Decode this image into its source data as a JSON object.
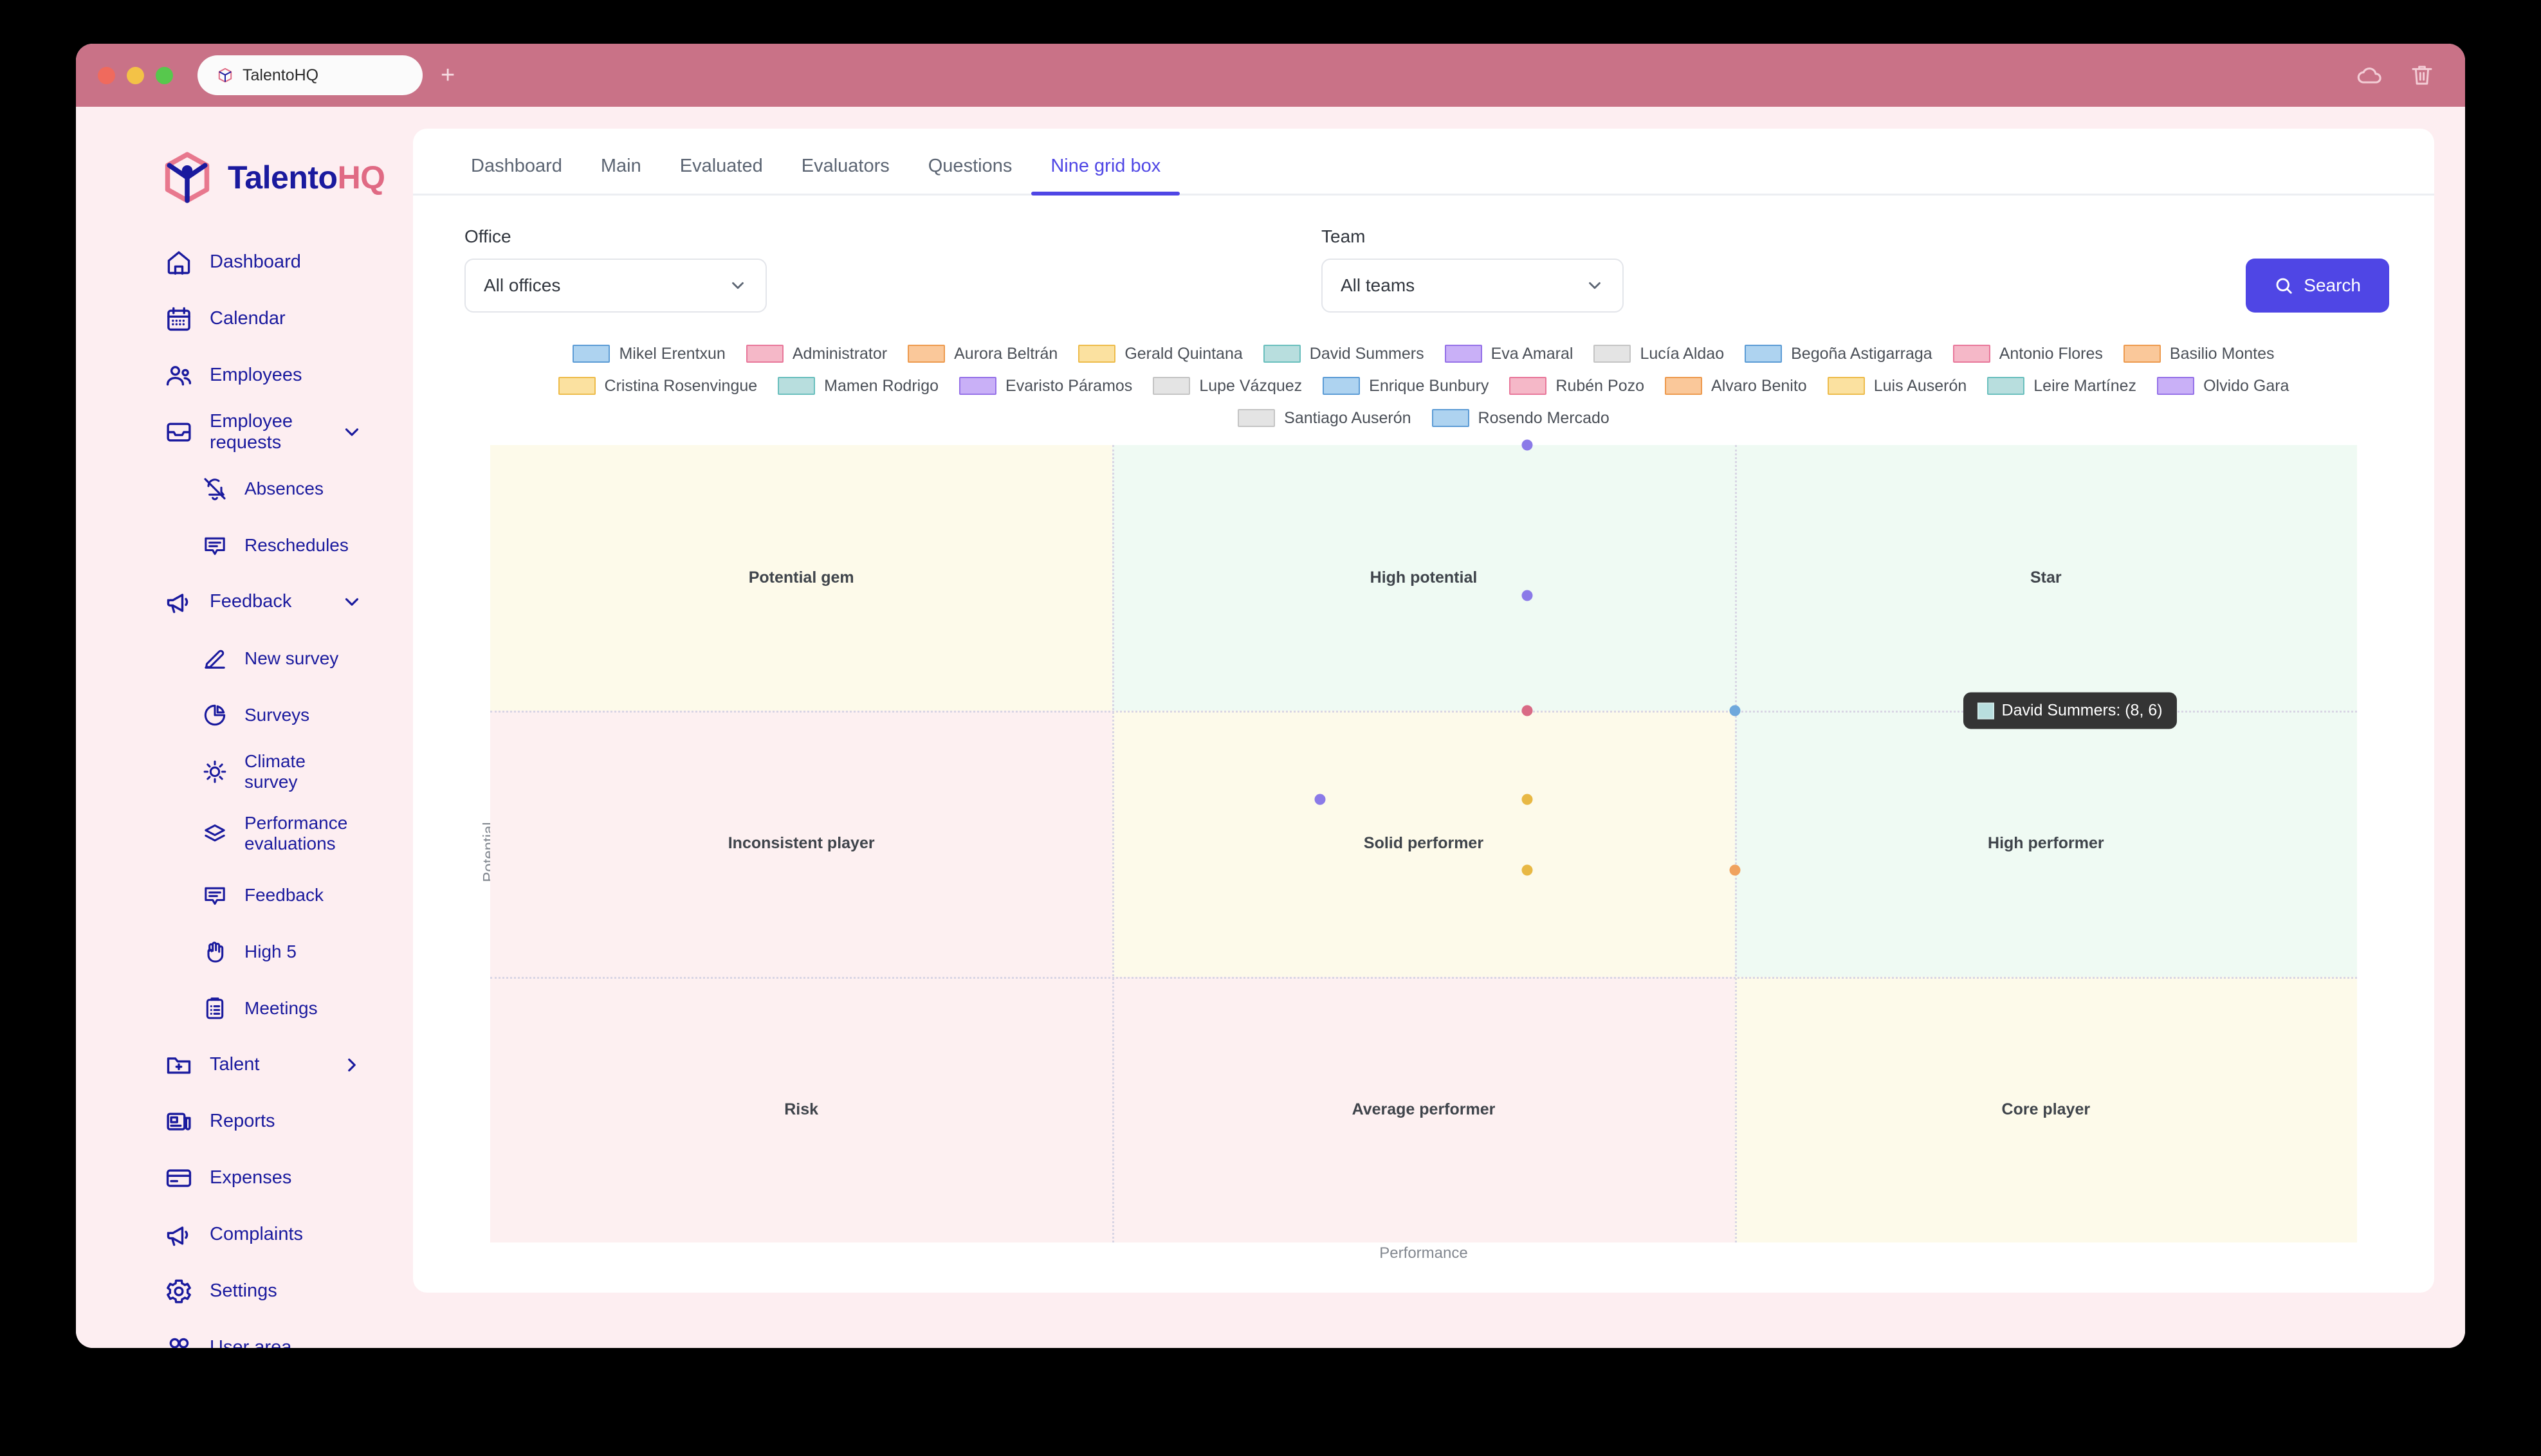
{
  "browser": {
    "tab_title": "TalentoHQ",
    "favicon": "cube-icon",
    "new_tab": "+",
    "cloud_icon": "cloud-icon",
    "trash_icon": "trash-icon"
  },
  "brand": {
    "name_primary": "Talento",
    "name_accent": "HQ",
    "logo": "cube-person-logo"
  },
  "sidebar": {
    "items": [
      {
        "label": "Dashboard",
        "icon": "home-icon",
        "level": 0,
        "chevron": ""
      },
      {
        "label": "Calendar",
        "icon": "calendar-icon",
        "level": 0,
        "chevron": ""
      },
      {
        "label": "Employees",
        "icon": "people-icon",
        "level": 0,
        "chevron": ""
      },
      {
        "label": "Employee requests",
        "icon": "inbox-icon",
        "level": 0,
        "chevron": "down"
      },
      {
        "label": "Absences",
        "icon": "bell-off-icon",
        "level": 1,
        "chevron": ""
      },
      {
        "label": "Reschedules",
        "icon": "chat-icon",
        "level": 1,
        "chevron": ""
      },
      {
        "label": "Feedback",
        "icon": "megaphone-icon",
        "level": 0,
        "chevron": "down"
      },
      {
        "label": "New survey",
        "icon": "edit-icon",
        "level": 1,
        "chevron": ""
      },
      {
        "label": "Surveys",
        "icon": "pie-chart-icon",
        "level": 1,
        "chevron": ""
      },
      {
        "label": "Climate survey",
        "icon": "sun-icon",
        "level": 1,
        "chevron": ""
      },
      {
        "label": "Performance evaluations",
        "icon": "layers-icon",
        "level": 1,
        "chevron": ""
      },
      {
        "label": "Feedback",
        "icon": "chat-icon",
        "level": 1,
        "chevron": ""
      },
      {
        "label": "High 5",
        "icon": "hand-icon",
        "level": 1,
        "chevron": ""
      },
      {
        "label": "Meetings",
        "icon": "clipboard-icon",
        "level": 1,
        "chevron": ""
      },
      {
        "label": "Talent",
        "icon": "folder-plus-icon",
        "level": 0,
        "chevron": "right"
      },
      {
        "label": "Reports",
        "icon": "news-icon",
        "level": 0,
        "chevron": ""
      },
      {
        "label": "Expenses",
        "icon": "card-icon",
        "level": 0,
        "chevron": ""
      },
      {
        "label": "Complaints",
        "icon": "megaphone-icon",
        "level": 0,
        "chevron": ""
      },
      {
        "label": "Settings",
        "icon": "gear-icon",
        "level": 0,
        "chevron": ""
      },
      {
        "label": "User area",
        "icon": "user-icon",
        "level": 0,
        "chevron": ""
      }
    ]
  },
  "tabs": [
    {
      "label": "Dashboard",
      "active": false
    },
    {
      "label": "Main",
      "active": false
    },
    {
      "label": "Evaluated",
      "active": false
    },
    {
      "label": "Evaluators",
      "active": false
    },
    {
      "label": "Questions",
      "active": false
    },
    {
      "label": "Nine grid box",
      "active": true
    }
  ],
  "filters": {
    "office_label": "Office",
    "office_value": "All offices",
    "team_label": "Team",
    "team_value": "All teams",
    "search_label": "Search"
  },
  "colors": {
    "accent": "#4f46e5",
    "brand_blue": "#1a1a9e",
    "brand_pink": "#e06a84",
    "chrome": "#c97287",
    "sidebar_bg": "#fdeef1",
    "tooltip_bg": "#343434"
  },
  "chart_data": {
    "type": "scatter",
    "title": "",
    "xlabel": "Performance",
    "ylabel": "Potential",
    "xlim": [
      0,
      9
    ],
    "ylim": [
      0,
      9
    ],
    "grid": true,
    "legend_position": "top",
    "cells": [
      {
        "label": "Potential gem",
        "row": 0,
        "col": 0,
        "fill": "#fdfaea"
      },
      {
        "label": "High potential",
        "row": 0,
        "col": 1,
        "fill": "#effaf3"
      },
      {
        "label": "Star",
        "row": 0,
        "col": 2,
        "fill": "#effaf3"
      },
      {
        "label": "Inconsistent player",
        "row": 1,
        "col": 0,
        "fill": "#fdf0f1"
      },
      {
        "label": "Solid performer",
        "row": 1,
        "col": 1,
        "fill": "#fdfaea"
      },
      {
        "label": "High performer",
        "row": 1,
        "col": 2,
        "fill": "#effaf3"
      },
      {
        "label": "Risk",
        "row": 2,
        "col": 0,
        "fill": "#fdf0f1"
      },
      {
        "label": "Average performer",
        "row": 2,
        "col": 1,
        "fill": "#fdf0f1"
      },
      {
        "label": "Core player",
        "row": 2,
        "col": 2,
        "fill": "#fdfaea"
      }
    ],
    "legend": [
      {
        "name": "Mikel Erentxun",
        "fill": "#aed3f0",
        "stroke": "#5b9bd5"
      },
      {
        "name": "Administrator",
        "fill": "#f5b8c8",
        "stroke": "#e8779a"
      },
      {
        "name": "Aurora Beltrán",
        "fill": "#fac89a",
        "stroke": "#ed9a4e"
      },
      {
        "name": "Gerald Quintana",
        "fill": "#fbe1a0",
        "stroke": "#edbb4a"
      },
      {
        "name": "David Summers",
        "fill": "#b8dede",
        "stroke": "#69bfbd"
      },
      {
        "name": "Eva Amaral",
        "fill": "#c9b0f7",
        "stroke": "#9571e8"
      },
      {
        "name": "Lucía Aldao",
        "fill": "#e4e4e4",
        "stroke": "#c4c4c4"
      },
      {
        "name": "Begoña Astigarraga",
        "fill": "#aed3f0",
        "stroke": "#5b9bd5"
      },
      {
        "name": "Antonio Flores",
        "fill": "#f5b8c8",
        "stroke": "#e8779a"
      },
      {
        "name": "Basilio Montes",
        "fill": "#fac89a",
        "stroke": "#ed9a4e"
      },
      {
        "name": "Cristina Rosenvingue",
        "fill": "#fbe1a0",
        "stroke": "#edbb4a"
      },
      {
        "name": "Mamen Rodrigo",
        "fill": "#b8dede",
        "stroke": "#69bfbd"
      },
      {
        "name": "Evaristo Páramos",
        "fill": "#c9b0f7",
        "stroke": "#9571e8"
      },
      {
        "name": "Lupe Vázquez",
        "fill": "#e4e4e4",
        "stroke": "#c4c4c4"
      },
      {
        "name": "Enrique Bunbury",
        "fill": "#aed3f0",
        "stroke": "#5b9bd5"
      },
      {
        "name": "Rubén Pozo",
        "fill": "#f5b8c8",
        "stroke": "#e8779a"
      },
      {
        "name": "Alvaro Benito",
        "fill": "#fac89a",
        "stroke": "#ed9a4e"
      },
      {
        "name": "Luis Auserón",
        "fill": "#fbe1a0",
        "stroke": "#edbb4a"
      },
      {
        "name": "Leire Martínez",
        "fill": "#b8dede",
        "stroke": "#69bfbd"
      },
      {
        "name": "Olvido Gara",
        "fill": "#c9b0f7",
        "stroke": "#9571e8"
      },
      {
        "name": "Santiago Auserón",
        "fill": "#e4e4e4",
        "stroke": "#c4c4c4"
      },
      {
        "name": "Rosendo Mercado",
        "fill": "#aed3f0",
        "stroke": "#5b9bd5"
      }
    ],
    "points": [
      {
        "name": "Eva Amaral",
        "x": 5.0,
        "y": 9.0,
        "color": "#8b7ae8"
      },
      {
        "name": "Evaristo Páramos",
        "x": 5.0,
        "y": 7.3,
        "color": "#8b7ae8"
      },
      {
        "name": "Antonio Flores",
        "x": 5.0,
        "y": 6.0,
        "color": "#d96a85"
      },
      {
        "name": "Begoña Astigarraga",
        "x": 6.0,
        "y": 6.0,
        "color": "#6fa8dc"
      },
      {
        "name": "Rubén Pozo",
        "x": 7.5,
        "y": 6.0,
        "color": "#ea8fa5"
      },
      {
        "name": "Olvido Gara",
        "x": 4.0,
        "y": 5.0,
        "color": "#8b7ae8"
      },
      {
        "name": "Luis Auserón",
        "x": 5.0,
        "y": 5.0,
        "color": "#e8b844"
      },
      {
        "name": "David Summers",
        "x": 8.0,
        "y": 6.0,
        "color": "#69bfbd"
      },
      {
        "name": "Cristina Rosenvingue",
        "x": 5.0,
        "y": 4.2,
        "color": "#e8b844"
      },
      {
        "name": "Alvaro Benito",
        "x": 6.0,
        "y": 4.2,
        "color": "#f0a25e"
      }
    ],
    "tooltip": {
      "visible": true,
      "text": "David Summers: (8, 6)",
      "swatch_fill": "#b8dede",
      "swatch_stroke": "#cfe9e8"
    }
  }
}
